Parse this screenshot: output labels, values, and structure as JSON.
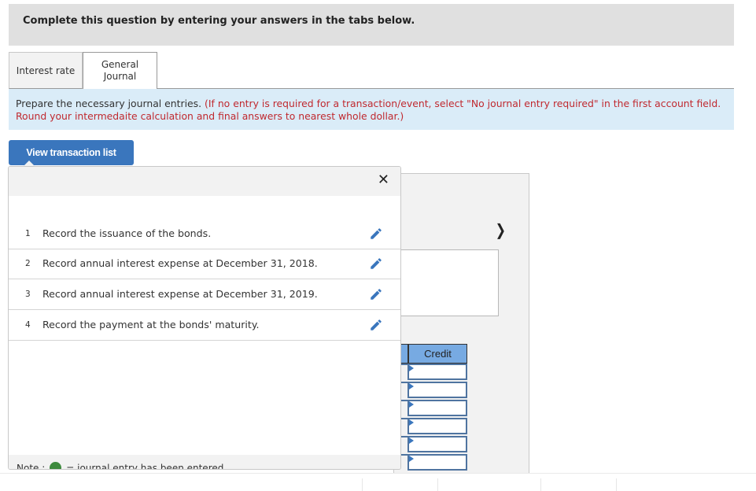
{
  "header": {
    "title": "Complete this question by entering your answers in the tabs below."
  },
  "tabs": [
    {
      "label": "Interest rate",
      "active": false
    },
    {
      "label": "General Journal",
      "label_line1": "General",
      "label_line2": "Journal",
      "active": true
    }
  ],
  "instructions": {
    "main": "Prepare the necessary journal entries.",
    "note": "(If no entry is required for a transaction/event, select \"No journal entry required\" in the first account field. Round your intermedaite calculation and final answers to nearest whole dollar.)"
  },
  "view_transaction_button": {
    "label": "View transaction list"
  },
  "transaction_popup": {
    "close_icon": "close-icon",
    "items": [
      {
        "number": "1",
        "text": "Record the issuance of the bonds.",
        "icon": "pencil-icon"
      },
      {
        "number": "2",
        "text": "Record annual interest expense at December 31, 2018.",
        "icon": "pencil-icon"
      },
      {
        "number": "3",
        "text": "Record annual interest expense at December 31, 2019.",
        "icon": "pencil-icon"
      },
      {
        "number": "4",
        "text": "Record the payment at the bonds' maturity.",
        "icon": "pencil-icon"
      }
    ],
    "footer": {
      "note_label": "Note :",
      "note_text": "= journal entry has been entered",
      "dot_color": "#3e8a3e"
    }
  },
  "journal_panel": {
    "next_icon": "chevron-right-icon",
    "credit_header": "Credit",
    "credit_rows": [
      "",
      "",
      "",
      "",
      "",
      ""
    ]
  },
  "colors": {
    "accent_blue": "#3a76bd",
    "instruction_bg": "#daecf8",
    "instruction_red": "#c0292f",
    "header_bg": "#e0e0e0",
    "credit_header_bg": "#77aae2"
  }
}
